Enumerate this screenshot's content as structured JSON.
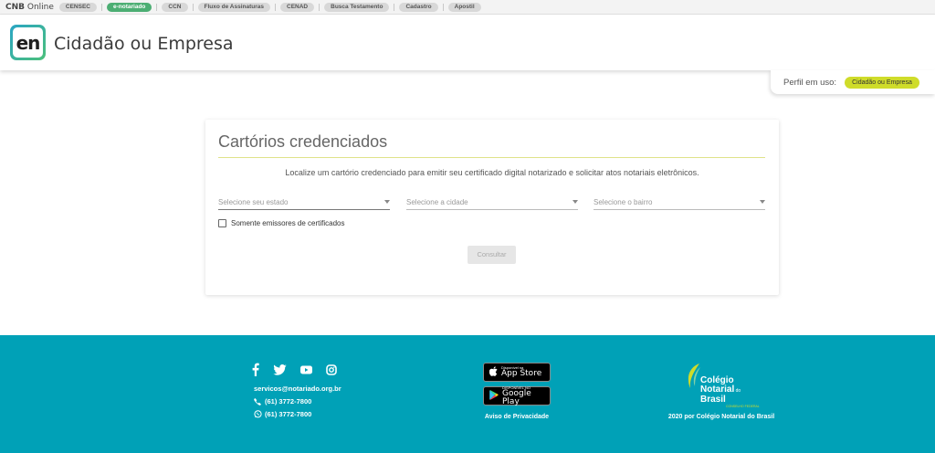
{
  "topbar": {
    "brand_bold": "CNB",
    "brand_rest": " Online",
    "links": [
      {
        "label": "CENSEC"
      },
      {
        "label": "e-notariado"
      },
      {
        "label": "CCN"
      },
      {
        "label": "Fluxo de Assinaturas"
      },
      {
        "label": "CENAD"
      },
      {
        "label": "Busca Testamento"
      },
      {
        "label": "Cadastro"
      },
      {
        "label": "Apostil"
      }
    ]
  },
  "header": {
    "logo_text": "en",
    "title": "Cidadão ou Empresa",
    "profile_label": "Perfil em uso:",
    "profile_value": "Cidadão ou Empresa"
  },
  "search": {
    "title": "Cartórios credenciados",
    "description": "Localize um cartório credenciado para emitir seu certificado digital notarizado e solicitar atos notariais eletrônicos.",
    "state_placeholder": "Selecione seu estado",
    "city_placeholder": "Selecione a cidade",
    "district_placeholder": "Selecione o bairro",
    "checkbox_label": "Somente emissores de certificados",
    "checkbox_checked": false,
    "submit_label": "Consultar"
  },
  "footer": {
    "social_icons": [
      "facebook-icon",
      "twitter-icon",
      "youtube-icon",
      "instagram-icon"
    ],
    "email": "servicos@notariado.org.br",
    "phone": "(61) 3772-7800",
    "whatsapp": "(61) 3772-7800",
    "appstore_small": "Disponível na",
    "appstore_big": "App Store",
    "googleplay_small": "DISPONÍVEL NO",
    "googleplay_big": "Google Play",
    "privacy_label": "Aviso de Privacidade",
    "org_line1": "Colégio",
    "org_line2": "Notarial",
    "org_line2_small": " do",
    "org_line3": "Brasil",
    "org_sub": "CONSELHO FEDERAL",
    "copyright": "2020 por Colégio Notarial do Brasil"
  },
  "colors": {
    "footer_bg": "#00a1b7",
    "accent_lime": "#cfdc2a",
    "active_pill": "#4cae73"
  }
}
